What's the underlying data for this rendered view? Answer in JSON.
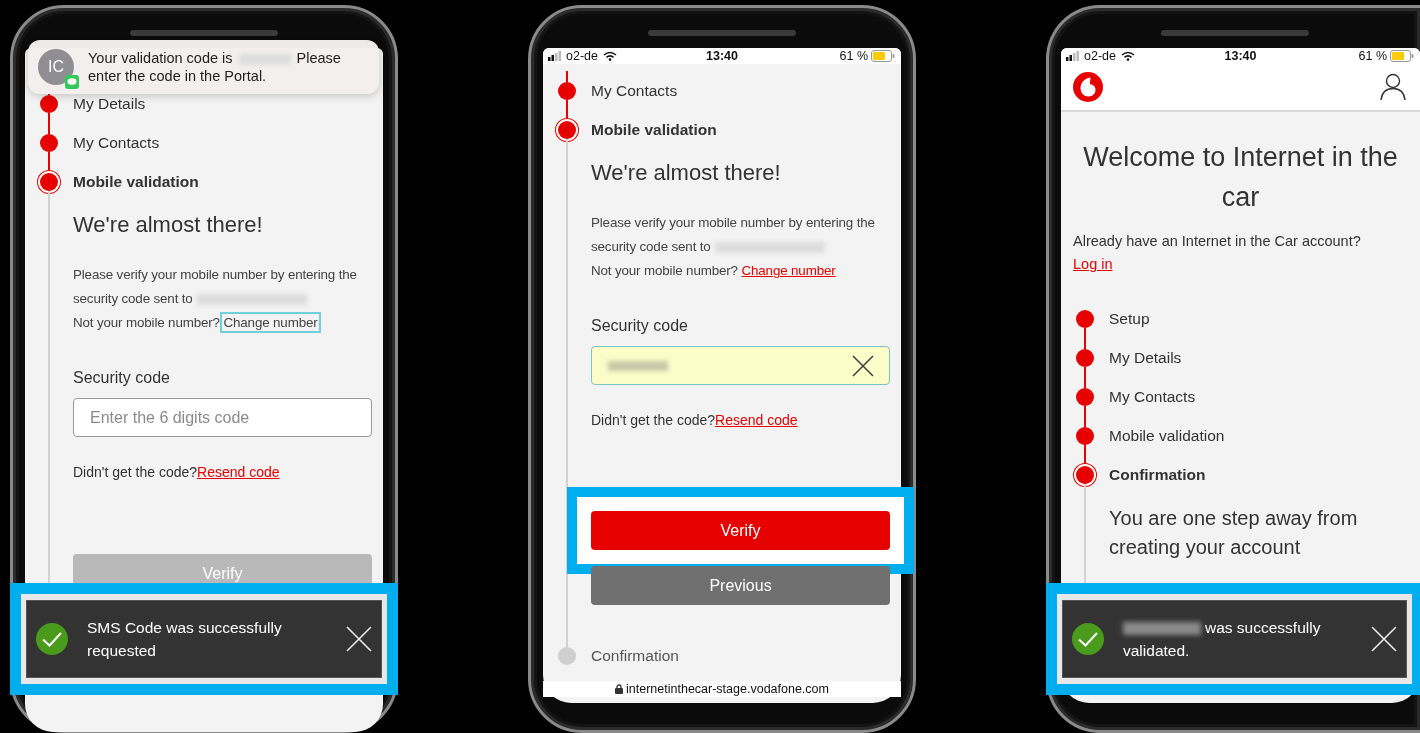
{
  "phones": [
    {
      "notification": {
        "avatar": "IC",
        "message_start": "Your validation code is",
        "message_end": "Please enter the code in the Portal."
      },
      "steps_continue_above": true,
      "steps": [
        {
          "label": "My Details",
          "done": true,
          "current": false
        },
        {
          "label": "My Contacts",
          "done": true,
          "current": false
        },
        {
          "label": "Mobile validation",
          "done": false,
          "current": true,
          "body": [
            {
              "kind": "heading",
              "text": "We're almost there!"
            },
            {
              "kind": "instructions",
              "text": "Please verify your mobile number by entering the security code sent to",
              "question": "Not your mobile number?",
              "link": "Change number",
              "link_focused": true
            },
            {
              "kind": "field",
              "label": "Security code",
              "placeholder": "Enter the 6 digits code",
              "filled": false
            },
            {
              "kind": "resend",
              "question": "Didn't get the code?",
              "link": "Resend code"
            },
            {
              "kind": "button",
              "label": "Verify",
              "disabled": true,
              "highlighted": false
            }
          ]
        }
      ],
      "toast": {
        "message": "SMS Code was successfully requested",
        "redacted_prefix": false,
        "highlighted": true
      }
    },
    {
      "status_bar": {
        "carrier": "o2-de",
        "time": "13:40",
        "battery": "61 %"
      },
      "steps_continue_above": true,
      "steps": [
        {
          "label": "My Contacts",
          "done": true,
          "current": false
        },
        {
          "label": "Mobile validation",
          "done": false,
          "current": true,
          "body": [
            {
              "kind": "heading",
              "text": "We're almost there!"
            },
            {
              "kind": "instructions",
              "text": "Please verify your mobile number by entering the security code sent to",
              "question": "Not your mobile number?",
              "link": "Change number",
              "link_focused": false
            },
            {
              "kind": "field",
              "label": "Security code",
              "filled": true
            },
            {
              "kind": "resend",
              "question": "Didn't get the code?",
              "link": "Resend code"
            },
            {
              "kind": "button",
              "label": "Verify",
              "disabled": false,
              "highlighted": true
            },
            {
              "kind": "button",
              "label": "Previous",
              "disabled": false,
              "highlighted": false
            }
          ]
        },
        {
          "label": "Confirmation",
          "done": false,
          "current": false
        }
      ],
      "url": "internetinthecar-stage.vodafone.com"
    },
    {
      "status_bar": {
        "carrier": "o2-de",
        "time": "13:40",
        "battery": "61 %"
      },
      "header": true,
      "title": "Welcome to Internet in the car",
      "login_prompt": {
        "text": "Already have an Internet in the Car account?",
        "link": "Log in"
      },
      "steps_continue_above": false,
      "steps": [
        {
          "label": "Setup",
          "done": true,
          "current": false
        },
        {
          "label": "My Details",
          "done": true,
          "current": false
        },
        {
          "label": "My Contacts",
          "done": true,
          "current": false
        },
        {
          "label": "Mobile validation",
          "done": true,
          "current": false
        },
        {
          "label": "Confirmation",
          "done": false,
          "current": true,
          "body": [
            {
              "kind": "subtitle",
              "text": "You are one step away from creating your account"
            }
          ]
        }
      ],
      "toast": {
        "message": "was successfully validated.",
        "redacted_prefix": true,
        "highlighted": true
      }
    }
  ]
}
